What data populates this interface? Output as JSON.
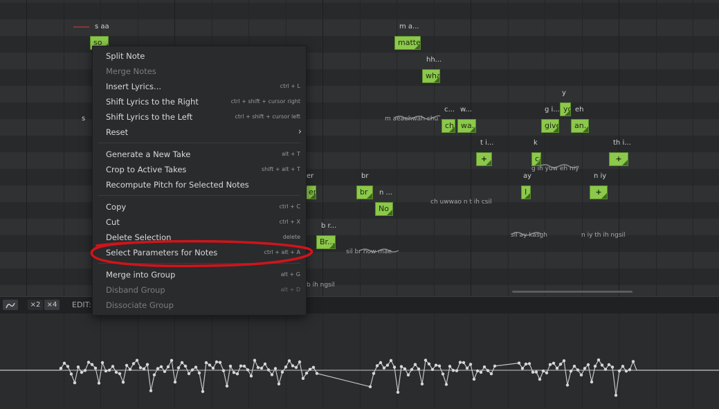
{
  "menu": {
    "items": [
      {
        "label": "Split Note",
        "shortcut": ""
      },
      {
        "label": "Merge Notes",
        "shortcut": ""
      },
      {
        "label": "Insert Lyrics...",
        "shortcut": "ctrl + L"
      },
      {
        "label": "Shift Lyrics to the Right",
        "shortcut": "ctrl + shift + cursor right"
      },
      {
        "label": "Shift Lyrics to the Left",
        "shortcut": "ctrl + shift + cursor left"
      },
      {
        "label": "Reset",
        "shortcut": ""
      },
      {
        "label": "Generate a New Take",
        "shortcut": "alt + T"
      },
      {
        "label": "Crop to Active Takes",
        "shortcut": "shift + alt + T"
      },
      {
        "label": "Recompute Pitch for Selected Notes",
        "shortcut": ""
      },
      {
        "label": "Copy",
        "shortcut": "ctrl + C"
      },
      {
        "label": "Cut",
        "shortcut": "ctrl + X"
      },
      {
        "label": "Delete Selection",
        "shortcut": "delete"
      },
      {
        "label": "Select Parameters for Notes",
        "shortcut": "ctrl + alt + A"
      },
      {
        "label": "Merge into Group",
        "shortcut": "alt + G"
      },
      {
        "label": "Disband Group",
        "shortcut": "alt + D"
      },
      {
        "label": "Dissociate Group",
        "shortcut": ""
      }
    ],
    "submenu_icon": "chevron-right-icon"
  },
  "notes": {
    "so": "so",
    "matter": "matter",
    "wha": "wha",
    "ch": "ch",
    "wa": "wa...",
    "yo": "yo",
    "give": "give",
    "an": "an...",
    "plus": "+",
    "ca": "ca",
    "i": "I",
    "br": "br",
    "no": "No",
    "er": "er",
    "br2": "Br..."
  },
  "lyrics": {
    "s_aa": "s aa",
    "m_a": "m a...",
    "hh": "hh...",
    "c": "c...",
    "w": "w...",
    "y": "y",
    "g_i": "g i...",
    "eh": "eh",
    "t_i": "t i...",
    "k": "k",
    "th_i": "th i...",
    "ay": "ay",
    "n_iy": "n iy",
    "br": "br",
    "n": "n ...",
    "er": "er",
    "b_r": "b r...",
    "s": "s"
  },
  "phonemes": {
    "p1": "m  aeaehwah chu",
    "p2": "g  ih  yuw  eh  niy",
    "p3": "ch  uwwao n t  ih  csil",
    "p4": "sil  ay kasgh",
    "p5": "n    iy  th  ih  ngsil",
    "p6": "sil   br  now mae",
    "p7": "b   ih ngsil"
  },
  "toolbar": {
    "x2": "×2",
    "x4": "×4",
    "edit": "EDIT:",
    "icons": [
      "curve-tool-icon"
    ]
  },
  "colors": {
    "note_fill": "#8cc84b",
    "annotation": "#d0141a",
    "menu_bg": "#2a2b2d",
    "pitch": "#c8c8c8"
  }
}
